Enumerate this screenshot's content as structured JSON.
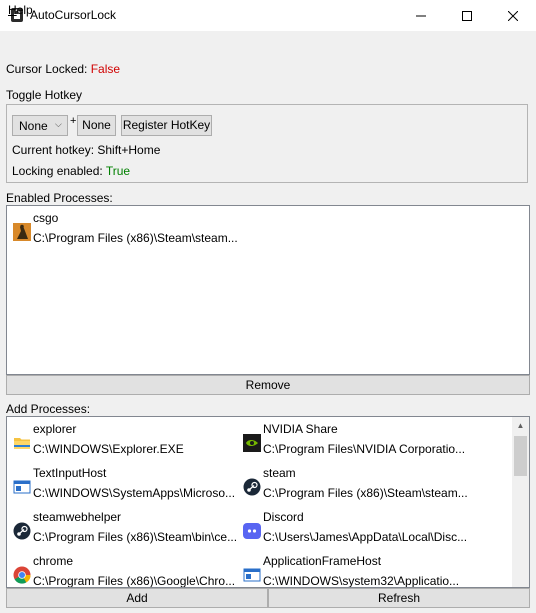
{
  "window": {
    "title": "AutoCursorLock",
    "controls": {
      "minimize": "—",
      "maximize": "☐",
      "close": "✕"
    }
  },
  "menu": {
    "help_first": "H",
    "help_rest": "elp"
  },
  "status": {
    "cursor_locked_label": "Cursor Locked: ",
    "cursor_locked_value": "False",
    "cursor_locked_color": "#d00000"
  },
  "hotkey": {
    "section_title": "Toggle Hotkey",
    "modifier_selected": "None",
    "plus": "+",
    "key_label": "None",
    "register_label": "Register HotKey",
    "current_label": "Current hotkey: ",
    "current_value": "Shift+Home",
    "locking_label": "Locking enabled: ",
    "locking_value": "True",
    "locking_color": "#008000"
  },
  "enabled": {
    "section_title": "Enabled Processes:",
    "items": [
      {
        "name": "csgo",
        "path": "C:\\Program Files (x86)\\Steam\\steam...",
        "icon": "csgo-icon"
      }
    ],
    "remove_label": "Remove"
  },
  "add": {
    "section_title": "Add Processes:",
    "items": [
      {
        "name": "explorer",
        "path": "C:\\WINDOWS\\Explorer.EXE",
        "icon": "folder-icon"
      },
      {
        "name": "NVIDIA Share",
        "path": "C:\\Program Files\\NVIDIA Corporatio...",
        "icon": "nvidia-icon"
      },
      {
        "name": "TextInputHost",
        "path": "C:\\WINDOWS\\SystemApps\\Microso...",
        "icon": "window-icon"
      },
      {
        "name": "steam",
        "path": "C:\\Program Files (x86)\\Steam\\steam...",
        "icon": "steam-icon"
      },
      {
        "name": "steamwebhelper",
        "path": "C:\\Program Files (x86)\\Steam\\bin\\ce...",
        "icon": "steam-icon"
      },
      {
        "name": "Discord",
        "path": "C:\\Users\\James\\AppData\\Local\\Disc...",
        "icon": "discord-icon"
      },
      {
        "name": "chrome",
        "path": "C:\\Program Files (x86)\\Google\\Chro...",
        "icon": "chrome-icon"
      },
      {
        "name": "ApplicationFrameHost",
        "path": "C:\\WINDOWS\\system32\\Applicatio...",
        "icon": "window-icon"
      }
    ],
    "add_label": "Add",
    "refresh_label": "Refresh"
  }
}
